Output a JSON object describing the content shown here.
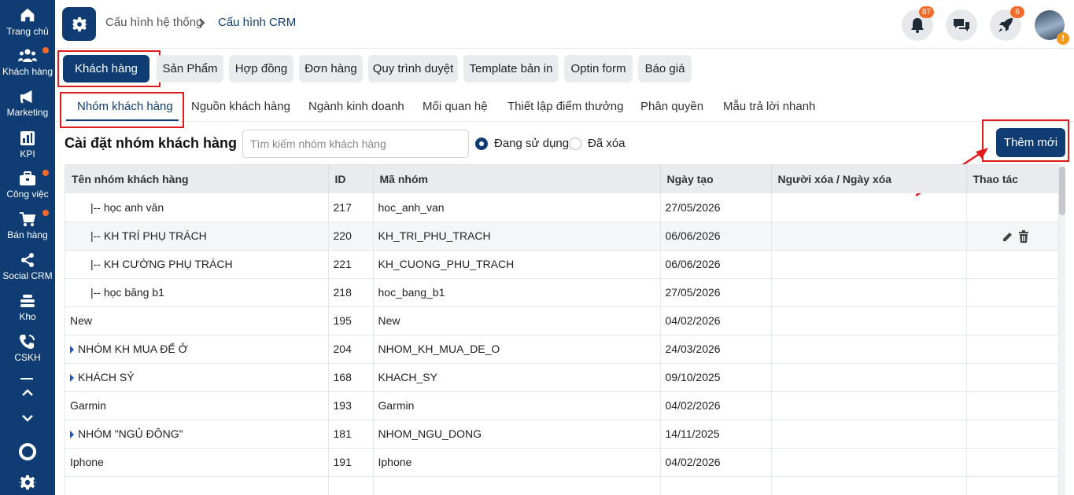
{
  "sidebar": {
    "items": [
      {
        "label": "Trang chủ",
        "icon": "home-icon"
      },
      {
        "label": "Khách hàng",
        "icon": "customers-icon"
      },
      {
        "label": "Marketing",
        "icon": "megaphone-icon"
      },
      {
        "label": "KPI",
        "icon": "kpi-icon"
      },
      {
        "label": "Công việc",
        "icon": "briefcase-icon"
      },
      {
        "label": "Bán hàng",
        "icon": "cart-icon"
      },
      {
        "label": "Social CRM",
        "icon": "share-icon"
      },
      {
        "label": "Kho",
        "icon": "warehouse-icon"
      },
      {
        "label": "CSKH",
        "icon": "phone-icon"
      }
    ]
  },
  "header": {
    "breadcrumb_parent": "Cấu hình hệ thống",
    "breadcrumb_current": "Cấu hình CRM",
    "notification_count": "87",
    "rocket_count": "6"
  },
  "top_tabs": [
    "Khách hàng",
    "Sản Phẩm",
    "Hợp đồng",
    "Đơn hàng",
    "Quy trình duyệt",
    "Template bản in",
    "Optin form",
    "Báo giá"
  ],
  "sub_tabs": [
    "Nhóm khách hàng",
    "Nguồn khách hàng",
    "Ngành kinh doanh",
    "Mối quan hệ",
    "Thiết lập điểm thưởng",
    "Phân quyền",
    "Mẫu trả lời nhanh"
  ],
  "toolbar": {
    "title": "Cài đặt nhóm khách hàng",
    "search_placeholder": "Tìm kiếm nhóm khách hàng",
    "radio_active": "Đang sử dụng",
    "radio_deleted": "Đã xóa",
    "add_label": "Thêm mới"
  },
  "table": {
    "headers": [
      "Tên nhóm khách hàng",
      "ID",
      "Mã nhóm",
      "Ngày tạo",
      "Người xóa / Ngày xóa",
      "Thao tác"
    ],
    "rows": [
      {
        "name": "|-- học anh văn",
        "id": "217",
        "code": "hoc_anh_van",
        "date": "27/05/2026",
        "deleted": ""
      },
      {
        "name": "|-- KH TRÍ PHỤ TRÁCH",
        "id": "220",
        "code": "KH_TRI_PHU_TRACH",
        "date": "06/06/2026",
        "deleted": ""
      },
      {
        "name": "|-- KH CƯỜNG PHỤ TRÁCH",
        "id": "221",
        "code": "KH_CUONG_PHU_TRACH",
        "date": "06/06/2026",
        "deleted": ""
      },
      {
        "name": "|-- học băng b1",
        "id": "218",
        "code": "hoc_bang_b1",
        "date": "27/05/2026",
        "deleted": ""
      },
      {
        "name": "New",
        "id": "195",
        "code": "New",
        "date": "04/02/2026",
        "deleted": ""
      },
      {
        "name": "NHÓM KH MUA ĐỂ Ở",
        "id": "204",
        "code": "NHOM_KH_MUA_DE_O",
        "date": "24/03/2026",
        "deleted": ""
      },
      {
        "name": "KHÁCH SỶ",
        "id": "168",
        "code": "KHACH_SY",
        "date": "09/10/2025",
        "deleted": ""
      },
      {
        "name": "Garmin",
        "id": "193",
        "code": "Garmin",
        "date": "04/02/2026",
        "deleted": ""
      },
      {
        "name": "NHÓM \"NGỦ ĐÔNG\"",
        "id": "181",
        "code": "NHOM_NGU_DONG",
        "date": "14/11/2025",
        "deleted": ""
      },
      {
        "name": "Iphone",
        "id": "191",
        "code": "Iphone",
        "date": "04/02/2026",
        "deleted": ""
      }
    ]
  },
  "colors": {
    "primary": "#0f3d73",
    "accent": "#f36b2a",
    "highlight": "#e01919"
  }
}
